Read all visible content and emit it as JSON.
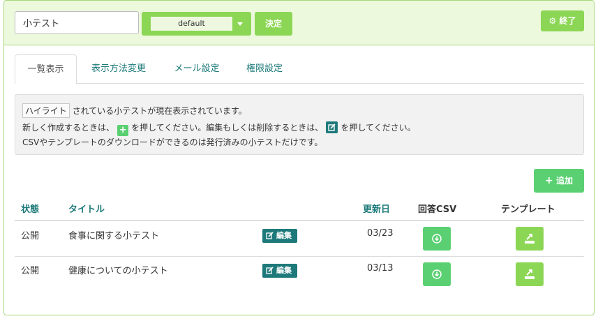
{
  "header": {
    "name_value": "小テスト",
    "select_value": "default",
    "decide_label": "決定",
    "exit_label": "終了"
  },
  "tabs": [
    {
      "label": "一覧表示",
      "active": true
    },
    {
      "label": "表示方法変更",
      "active": false
    },
    {
      "label": "メール設定",
      "active": false
    },
    {
      "label": "権限設定",
      "active": false
    }
  ],
  "info": {
    "highlight_word": "ハイライト",
    "line1_rest": "されている小テストが現在表示されています。",
    "line2_a": "新しく作成するときは、",
    "line2_b": "を押してください。編集もしくは削除するときは、",
    "line2_c": "を押してください。",
    "line3": "CSVやテンプレートのダウンロードができるのは発行済みの小テストだけです。"
  },
  "add_label": "追加",
  "table": {
    "columns": {
      "status": "状態",
      "title": "タイトル",
      "updated": "更新日",
      "csv": "回答CSV",
      "template": "テンプレート"
    },
    "edit_label": "編集",
    "rows": [
      {
        "status": "公開",
        "title": "食事に関する小テスト",
        "updated": "03/23"
      },
      {
        "status": "公開",
        "title": "健康についての小テスト",
        "updated": "03/13"
      }
    ]
  },
  "colors": {
    "accent_green": "#8cd655",
    "bright_green": "#5ad072",
    "teal": "#1e7a7a",
    "header_bg": "#edf9dc"
  }
}
